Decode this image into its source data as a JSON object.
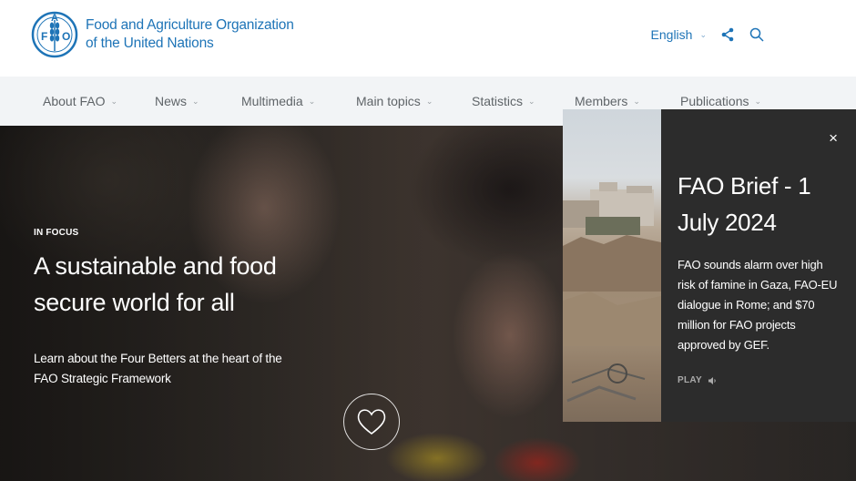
{
  "header": {
    "org_name_line1": "Food and Agriculture Organization",
    "org_name_line2": "of the United Nations",
    "logo_text": "FAO",
    "logo_motto": "FIAT PANIS",
    "language": "English"
  },
  "nav": {
    "items": [
      {
        "label": "About FAO"
      },
      {
        "label": "News"
      },
      {
        "label": "Multimedia"
      },
      {
        "label": "Main topics"
      },
      {
        "label": "Statistics"
      },
      {
        "label": "Members"
      },
      {
        "label": "Publications"
      }
    ]
  },
  "hero": {
    "eyebrow": "IN FOCUS",
    "headline": "A sustainable and food secure world for all",
    "subtext": "Learn about the Four Betters at the heart of the FAO Strategic Framework"
  },
  "popup": {
    "title": "FAO Brief - 1 July 2024",
    "body": "FAO sounds alarm over high risk of famine in Gaza, FAO-EU dialogue in Rome; and $70 million for FAO projects approved by GEF.",
    "play_label": "PLAY",
    "close_label": "×"
  },
  "colors": {
    "brand_blue": "#1e74b7",
    "nav_bg": "#f2f4f6",
    "popup_bg": "#2c2c2c"
  }
}
